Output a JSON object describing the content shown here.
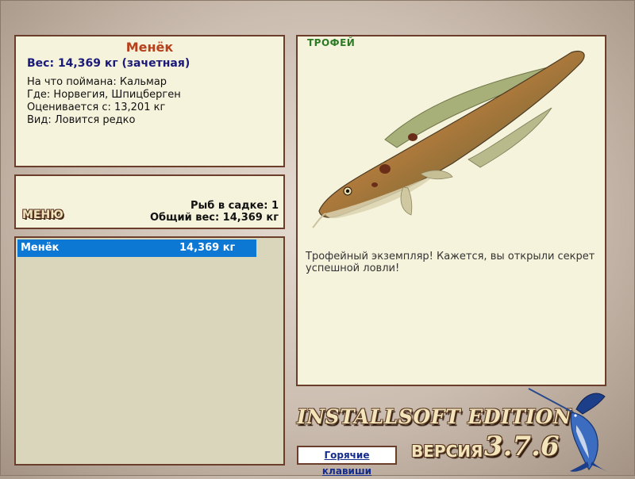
{
  "info": {
    "name": "Менёк",
    "weight": "Вес: 14,369 кг (зачетная)",
    "bait": "На что поймана: Кальмар",
    "location": "Где: Норвегия, Шпицберген",
    "valued_from": "Оценивается с: 13,201 кг",
    "rarity": "Вид: Ловится редко"
  },
  "status": {
    "menu_label": "МЕНЮ",
    "fish_count": "Рыб в садке: 1",
    "total_weight": "Общий вес: 14,369 кг"
  },
  "catch_list": [
    {
      "name": "Менёк",
      "weight": "14,369 кг"
    }
  ],
  "trophy": {
    "label": "ТРОФЕЙ",
    "description": "Трофейный экземпляр! Кажется, вы открыли секрет успешной ловли!"
  },
  "footer": {
    "edition": "INSTALLSOFT EDITION",
    "hotkeys_label": "Горячие клавиши",
    "version_word": "ВЕРСИЯ",
    "version_number": "3.7.6"
  },
  "colors": {
    "panel_bg": "#f6f3dc",
    "panel_border": "#6a3e2a",
    "selection": "#0c78d4",
    "fish_name": "#b6401b",
    "weight_text": "#1a1a7a",
    "trophy_label": "#2c7a25"
  },
  "icons": {
    "fish_picture": "burbot-fish-image",
    "logo": "marlin-logo"
  }
}
